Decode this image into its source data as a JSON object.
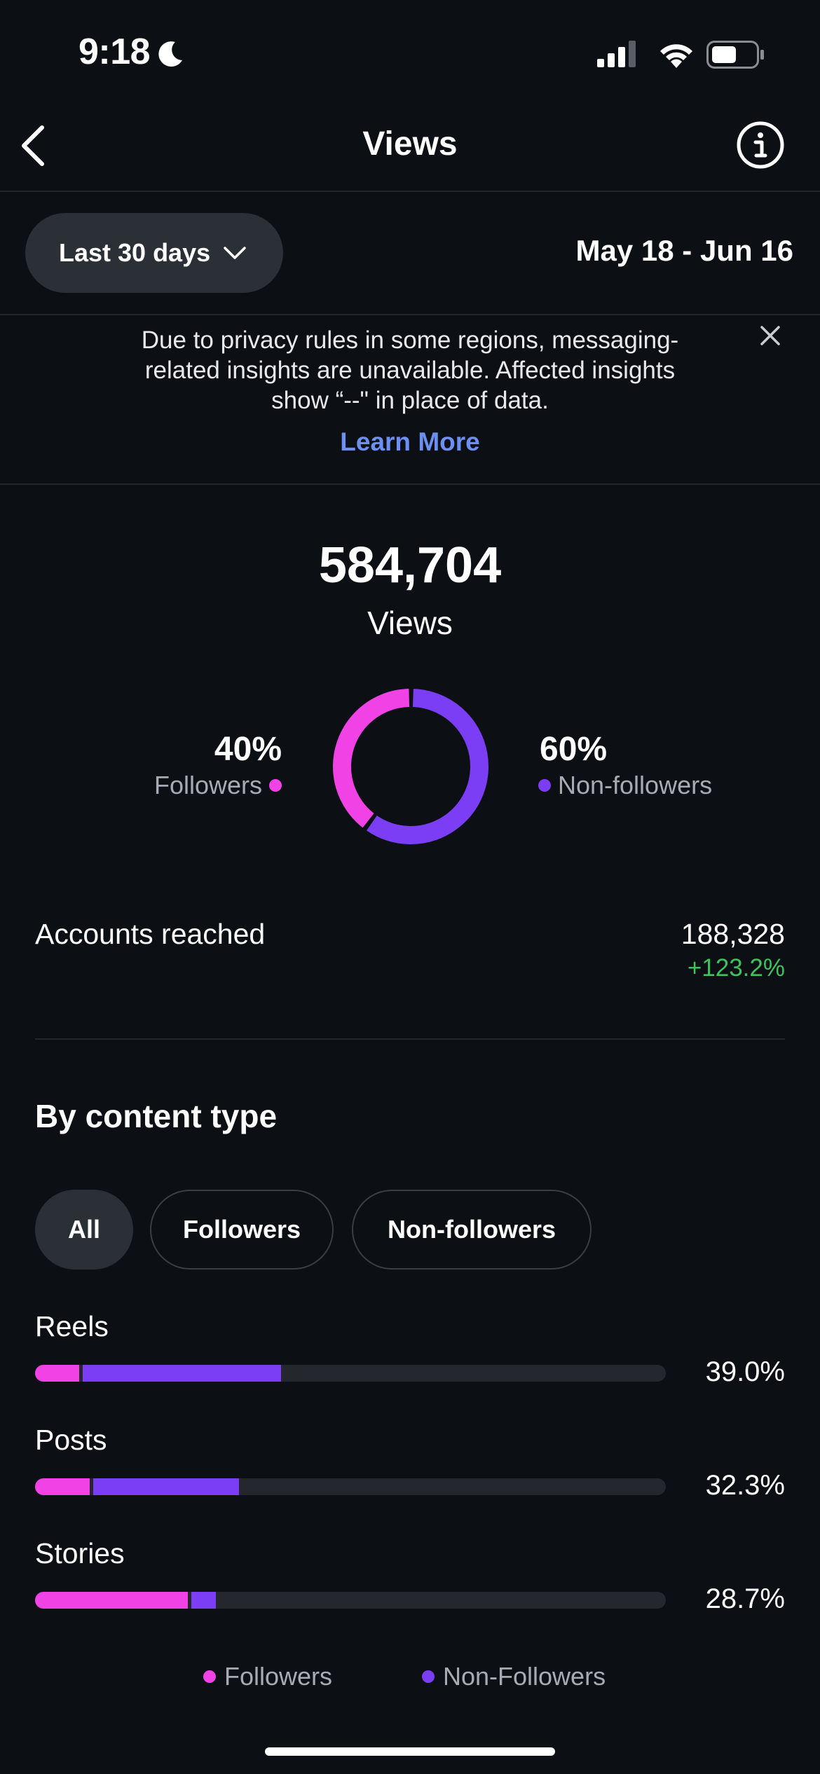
{
  "status_bar": {
    "time": "9:18"
  },
  "nav": {
    "title": "Views"
  },
  "filter": {
    "range_label": "Last 30 days",
    "date_range": "May 18 - Jun 16"
  },
  "banner": {
    "line1": "Due to privacy rules in some regions, messaging-",
    "line2": "related insights are unavailable. Affected insights",
    "line3": "show “--\" in place of data.",
    "link": "Learn More"
  },
  "summary": {
    "total": "584,704",
    "total_label": "Views",
    "followers_pct": "40%",
    "followers_label": "Followers",
    "nonfollowers_pct": "60%",
    "nonfollowers_label": "Non-followers",
    "followers_share": 0.4,
    "nonfollowers_share": 0.6
  },
  "accounts": {
    "label": "Accounts reached",
    "value": "188,328",
    "delta": "+123.2%"
  },
  "content": {
    "heading": "By content type",
    "chips": [
      "All",
      "Followers",
      "Non-followers"
    ],
    "rows": [
      {
        "label": "Reels",
        "pct": "39.0%",
        "followers": 7.0,
        "nonfollowers": 32.0
      },
      {
        "label": "Posts",
        "pct": "32.3%",
        "followers": 8.7,
        "nonfollowers": 23.6
      },
      {
        "label": "Stories",
        "pct": "28.7%",
        "followers": 24.2,
        "nonfollowers": 4.5
      }
    ],
    "legend": [
      "Followers",
      "Non-Followers"
    ]
  },
  "colors": {
    "followers": "#f143e5",
    "nonfollowers": "#7b3ef5",
    "positive": "#3ec25a",
    "link": "#6e8ff2"
  }
}
